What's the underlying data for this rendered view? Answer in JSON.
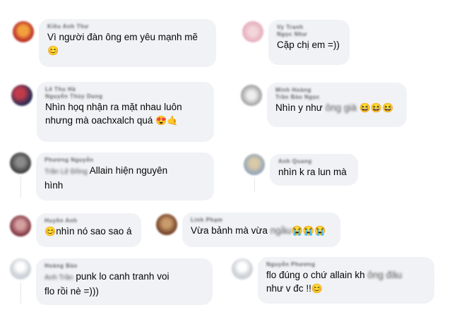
{
  "comments": [
    {
      "name": "Kiều Anh Thư",
      "text": "Vì người đàn ông em yêu mạnh mẽ",
      "emoji": "😊",
      "avatar_color": "#c0392b"
    },
    {
      "name": "Vy Tranh",
      "name2": "Ngọc Như",
      "text": "Cặp chị em =))",
      "avatar_color": "#e8b4c0"
    },
    {
      "name": "Lê Thu Hà",
      "name2": "Nguyễn Thùy Dung",
      "text_line1": "Nhìn họq nhận ra mặt nhau luôn",
      "text_line2": "nhưng mà oachxalch quá",
      "emoji": "😍🤙",
      "avatar_color": "#3b3b6b"
    },
    {
      "name": "Minh Hoàng",
      "name2": "Trần Bảo Ngọc",
      "text": "Nhìn y như",
      "hidden": "ông già",
      "emoji": "😆😆😆",
      "avatar_color": "#9e9e9e"
    },
    {
      "name": "Phương Nguyễn",
      "hidden_prefix": "Trần Lệ Đông",
      "text_line1": "Allain hiện nguyên",
      "text_line2": "hình",
      "avatar_color": "#4a4a4a"
    },
    {
      "name": "Anh Quang",
      "text": "nhìn k ra lun mà",
      "avatar_color": "#8fa3b8"
    },
    {
      "name": "Huyền Anh",
      "text": "nhìn nó sao sao á",
      "emoji": "😊",
      "avatar_color": "#7a2e3a"
    },
    {
      "name": "Linh Phạm",
      "text": "Vừa bảnh mà vừa",
      "hidden": "ngầu",
      "emoji": "😭😭😭",
      "avatar_color": "#6b3a1f"
    },
    {
      "name": "Hoàng Bảo",
      "hidden_prefix": "Anh Trần",
      "text_line1": "punk lo canh tranh voi",
      "text_line2": "flo rồi nè =)))",
      "avatar_color": "#cfd3d9"
    },
    {
      "name": "Nguyễn Phương",
      "text_line1": "flo đúng o chứ allain kh",
      "hidden": "ông đâu",
      "text_line2": "như v đc !!",
      "emoji": "😊",
      "avatar_color": "#cfd3d9"
    }
  ]
}
